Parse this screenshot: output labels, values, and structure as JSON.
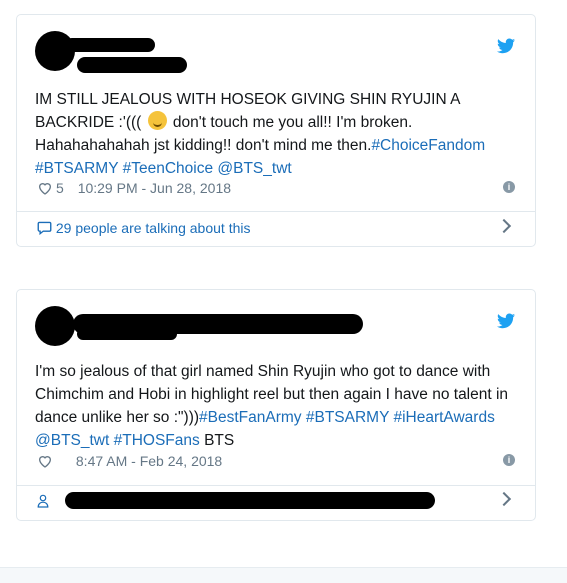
{
  "tweets": [
    {
      "text_parts": [
        "IM STILL JEALOUS WITH HOSEOK GIVING SHIN RYUJIN A BACKRIDE :'((( ",
        " don't touch me you all!! I'm broken. Hahahahahahah jst kidding!! don't mind me then.",
        "#ChoiceFandom",
        "#BTSARMY",
        "#TeenChoice",
        "@BTS_twt"
      ],
      "like_count": "5",
      "timestamp": "10:29 PM - Jun 28, 2018",
      "footer_text": "29 people are talking about this"
    },
    {
      "text_parts": [
        "I'm so jealous of that girl named Shin Ryujin who got to dance with Chimchim and Hobi in highlight reel but then again I have no talent in dance unlike her so :\")))",
        "#BestFanArmy",
        "#BTSARMY",
        "#iHeartAwards",
        "@BTS_twt",
        "#THOSFans",
        " BTS"
      ],
      "like_count": "",
      "timestamp": "8:47 AM - Feb 24, 2018",
      "footer_text": ""
    }
  ],
  "icons": {
    "brand": "twitter-bird-icon",
    "like": "heart-icon",
    "info": "info-icon",
    "conversation": "speech-bubble-icon",
    "person": "person-icon",
    "more": "chevron-right-icon"
  },
  "colors": {
    "link": "#1b6db8",
    "twitter_blue": "#1da1f2",
    "meta_gray": "#657786",
    "border": "#e1e8ed"
  }
}
